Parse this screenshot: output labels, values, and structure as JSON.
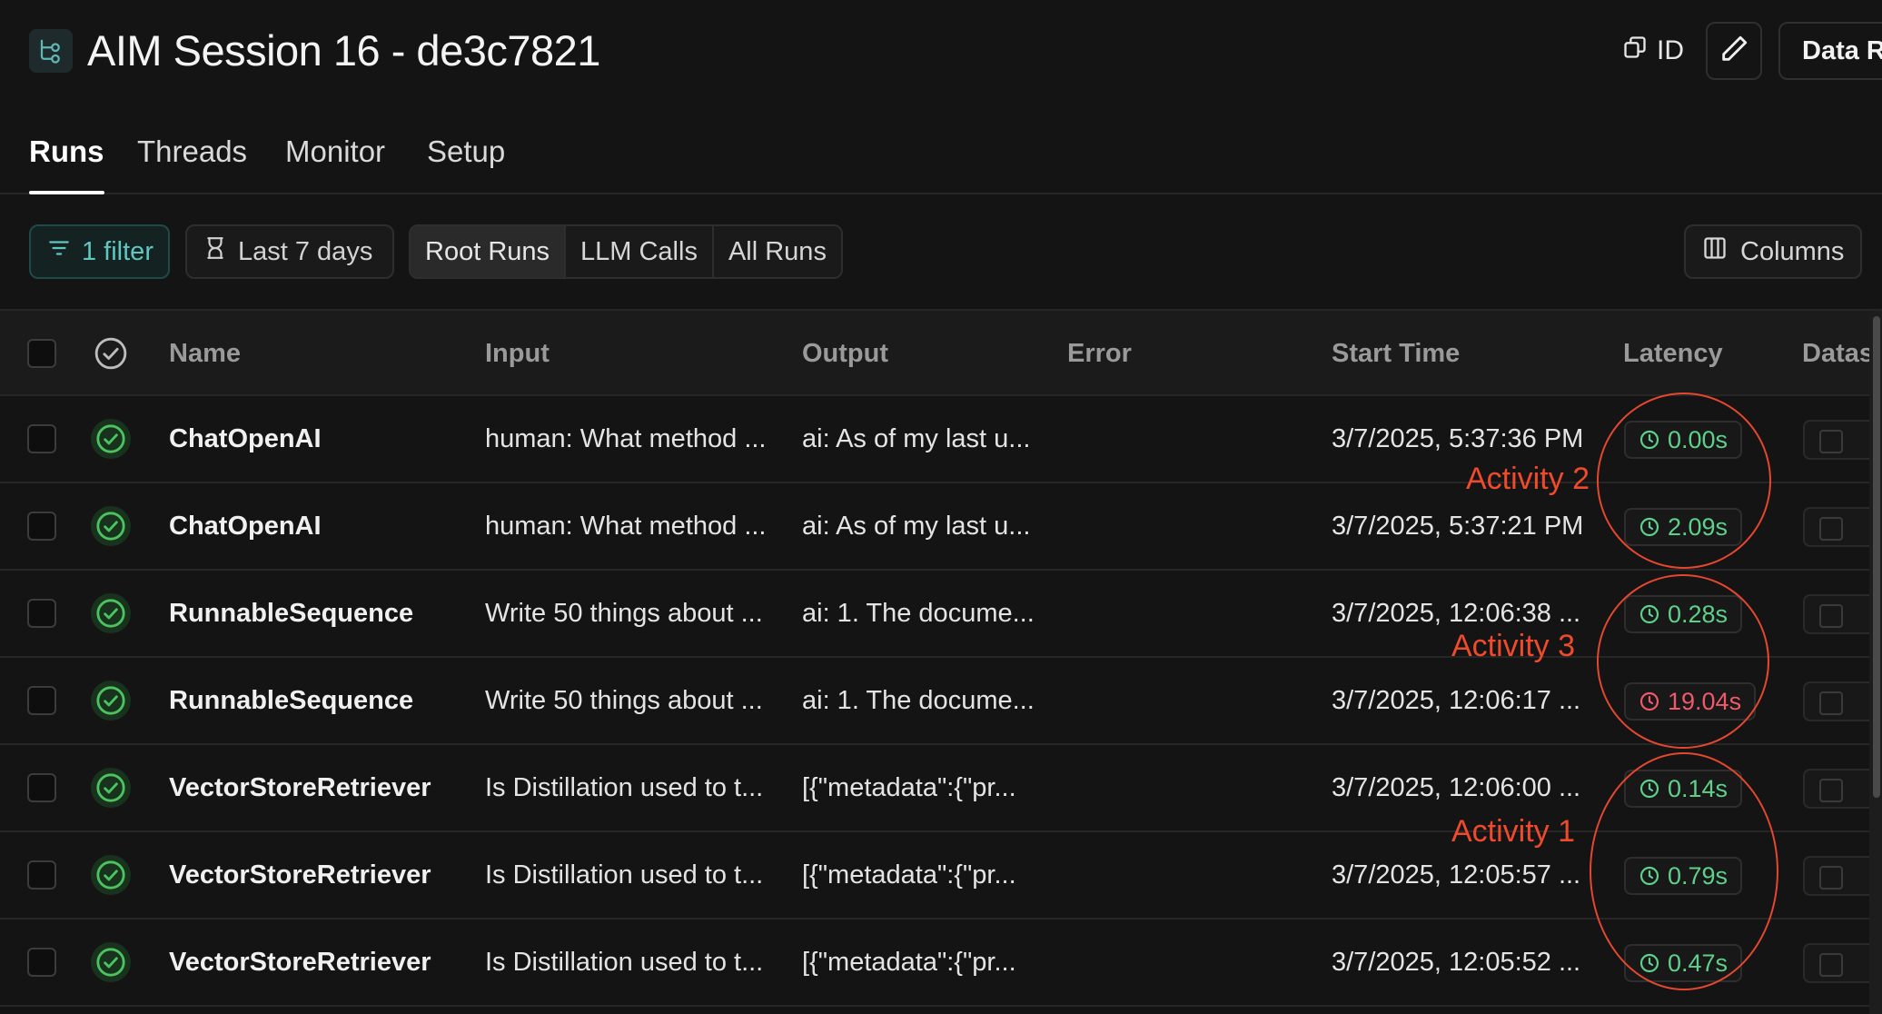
{
  "header": {
    "title": "AIM Session 16 - de3c7821",
    "id_label": "ID",
    "dataset_button_label": "Data R"
  },
  "tabs": [
    {
      "label": "Runs",
      "active": true
    },
    {
      "label": "Threads",
      "active": false
    },
    {
      "label": "Monitor",
      "active": false
    },
    {
      "label": "Setup",
      "active": false
    }
  ],
  "toolbar": {
    "filter_label": "1 filter",
    "date_range_label": "Last 7 days",
    "run_types": [
      {
        "label": "Root Runs",
        "selected": true
      },
      {
        "label": "LLM Calls",
        "selected": false
      },
      {
        "label": "All Runs",
        "selected": false
      }
    ],
    "columns_label": "Columns"
  },
  "table": {
    "headers": {
      "name": "Name",
      "input": "Input",
      "output": "Output",
      "error": "Error",
      "start_time": "Start Time",
      "latency": "Latency",
      "dataset": "Datas"
    },
    "rows": [
      {
        "name": "ChatOpenAI",
        "input": "human: What method ...",
        "output": "ai: As of my last u...",
        "error": "",
        "start_time": "3/7/2025, 5:37:36 PM",
        "latency": "0.00s",
        "slow": false
      },
      {
        "name": "ChatOpenAI",
        "input": "human: What method ...",
        "output": "ai: As of my last u...",
        "error": "",
        "start_time": "3/7/2025, 5:37:21 PM",
        "latency": "2.09s",
        "slow": false
      },
      {
        "name": "RunnableSequence",
        "input": "Write 50 things about ...",
        "output": "ai: 1. The docume...",
        "error": "",
        "start_time": "3/7/2025, 12:06:38 ...",
        "latency": "0.28s",
        "slow": false
      },
      {
        "name": "RunnableSequence",
        "input": "Write 50 things about ...",
        "output": "ai: 1. The docume...",
        "error": "",
        "start_time": "3/7/2025, 12:06:17 ...",
        "latency": "19.04s",
        "slow": true
      },
      {
        "name": "VectorStoreRetriever",
        "input": "Is Distillation used to t...",
        "output": "[{\"metadata\":{\"pr...",
        "error": "",
        "start_time": "3/7/2025, 12:06:00 ...",
        "latency": "0.14s",
        "slow": false
      },
      {
        "name": "VectorStoreRetriever",
        "input": "Is Distillation used to t...",
        "output": "[{\"metadata\":{\"pr...",
        "error": "",
        "start_time": "3/7/2025, 12:05:57 ...",
        "latency": "0.79s",
        "slow": false
      },
      {
        "name": "VectorStoreRetriever",
        "input": "Is Distillation used to t...",
        "output": "[{\"metadata\":{\"pr...",
        "error": "",
        "start_time": "3/7/2025, 12:05:52 ...",
        "latency": "0.47s",
        "slow": false
      }
    ]
  },
  "annotations": [
    {
      "label": "Activity 2"
    },
    {
      "label": "Activity 3"
    },
    {
      "label": "Activity 1"
    }
  ],
  "colors": {
    "background": "#141414",
    "accent_teal": "#5fc6c0",
    "success_green": "#5fd08a",
    "error_red": "#f0596a",
    "annotation_red": "#e4472f"
  }
}
